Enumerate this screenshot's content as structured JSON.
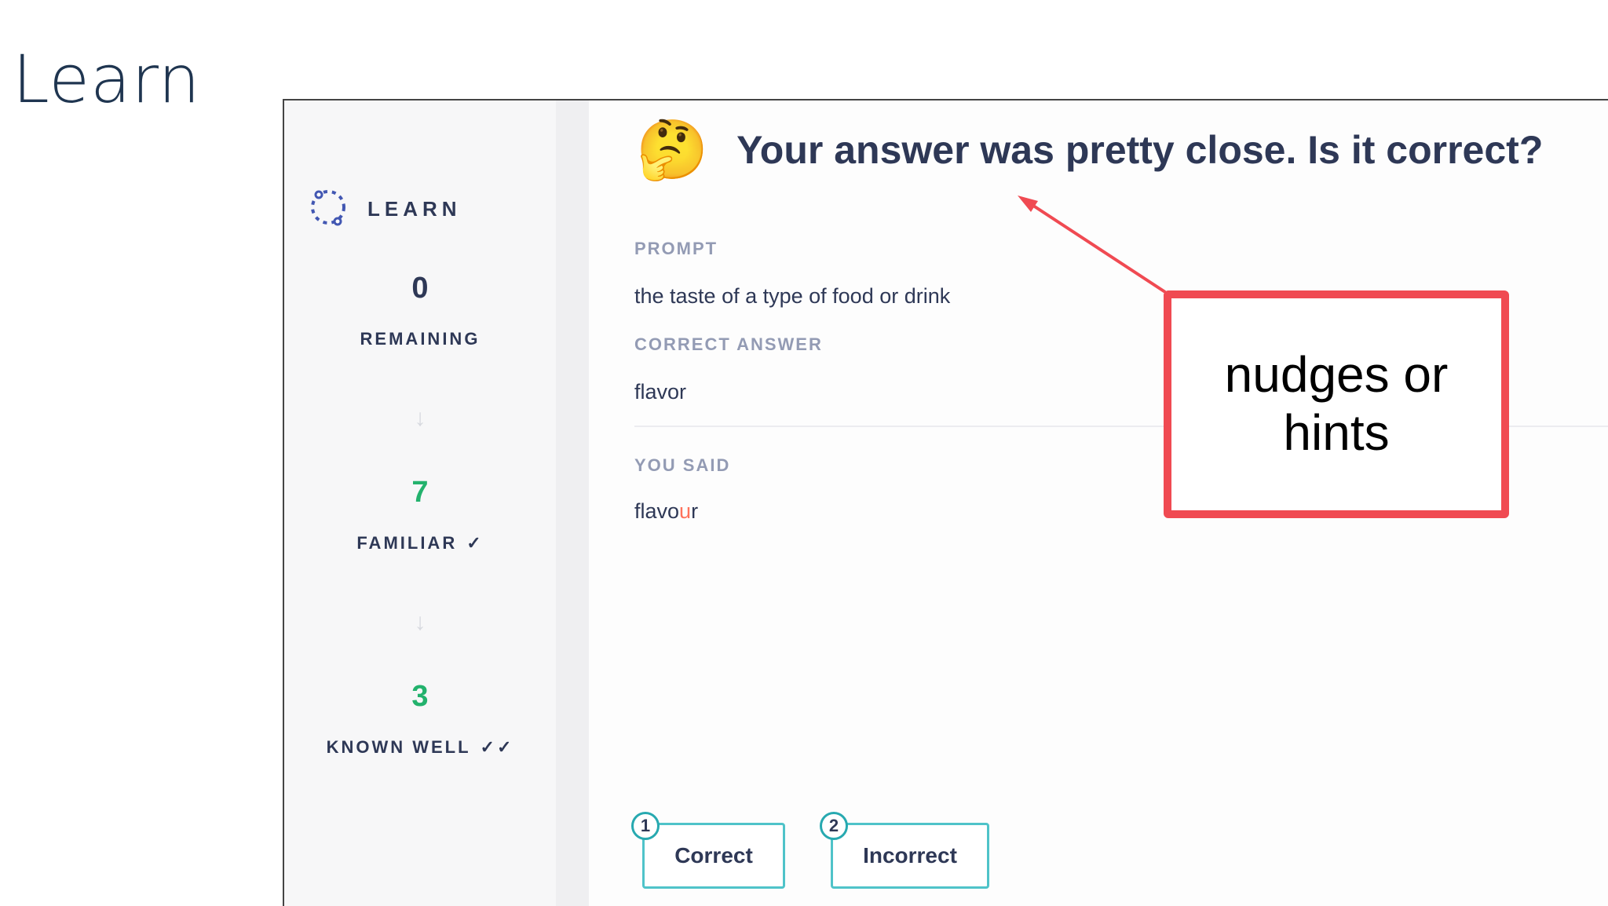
{
  "slide": {
    "title": "Learn"
  },
  "sidebar": {
    "mode_label": "LEARN",
    "remaining": {
      "count": "0",
      "label": "REMAINING"
    },
    "familiar": {
      "count": "7",
      "label": "FAMILIAR"
    },
    "known_well": {
      "count": "3",
      "label": "KNOWN WELL"
    }
  },
  "question": {
    "headline": "Your answer was pretty close. Is it correct?",
    "prompt_label": "PROMPT",
    "prompt_text": "the taste of a type of food or drink",
    "correct_label": "CORRECT ANSWER",
    "correct_text": "flavor",
    "you_said_label": "YOU SAID",
    "you_said_prefix": "flavo",
    "you_said_diff": "u",
    "you_said_suffix": "r"
  },
  "actions": {
    "correct": {
      "key": "1",
      "label": "Correct"
    },
    "incorrect": {
      "key": "2",
      "label": "Incorrect"
    }
  },
  "annotation": {
    "text": "nudges or hints"
  },
  "colors": {
    "accent_teal": "#4fc3c9",
    "familiar_green": "#23b26d",
    "annotation_red": "#f04a52",
    "diff_orange": "#ff725b",
    "text_navy": "#2e3856"
  },
  "icons": {
    "learn": "dotted-circle-icon",
    "headline": "thinking-face-emoji",
    "step_arrow": "arrow-down-icon",
    "familiar": "check-icon",
    "known_well": "double-check-icon"
  }
}
